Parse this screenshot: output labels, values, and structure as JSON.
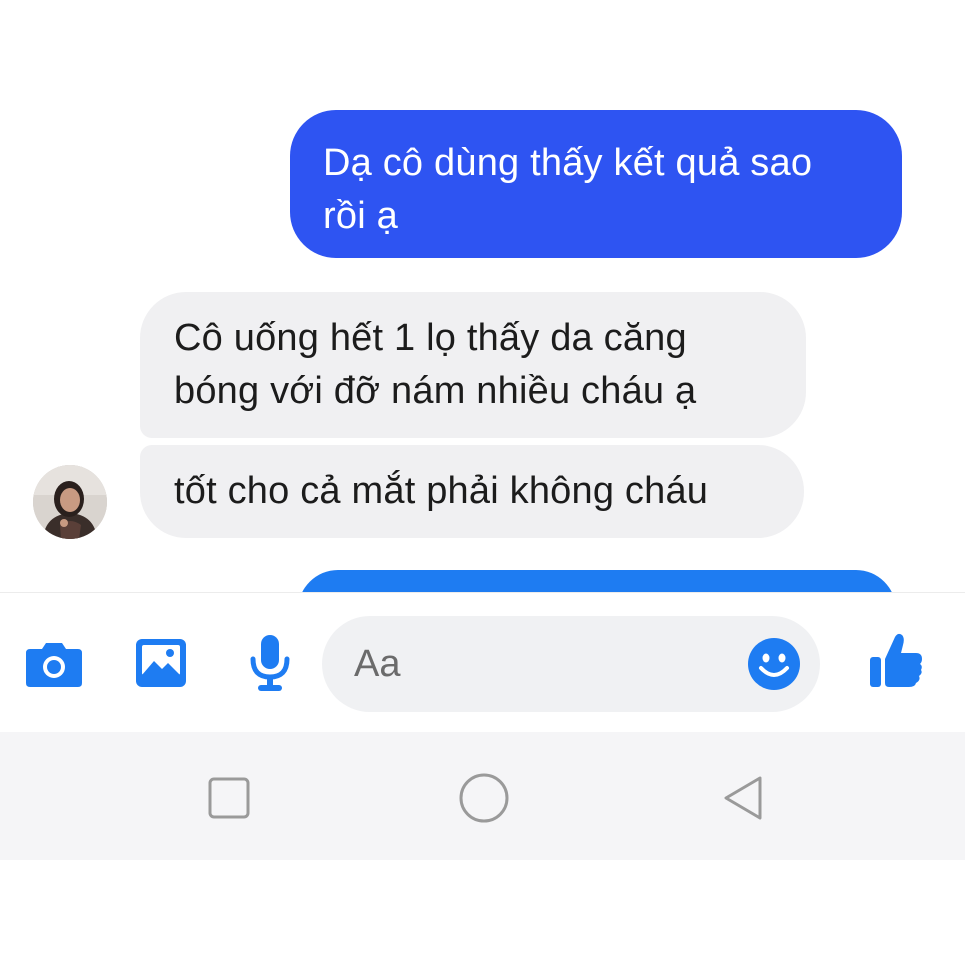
{
  "messages": {
    "sent_1_line_1": "Dạ cô dùng thấy kết quả sao",
    "sent_1_line_2": "rồi ạ",
    "received_1_line_1": "Cô uống hết 1 lọ thấy da căng",
    "received_1_line_2": "bóng với đỡ nám nhiều cháu ạ",
    "received_2": "tốt cho cả mắt phải không cháu"
  },
  "composer": {
    "placeholder": "Aa",
    "tools": [
      "camera-icon",
      "gallery-icon",
      "microphone-icon",
      "emoji-icon",
      "thumbs-up-icon"
    ]
  },
  "navbar": {
    "buttons": [
      "recent-apps-icon",
      "home-icon",
      "back-icon"
    ]
  },
  "colors": {
    "sent_bubble": "#2e54f2",
    "received_bubble": "#f0f0f2",
    "accent": "#1e7cf2",
    "navbar_bg": "#f5f5f7"
  }
}
